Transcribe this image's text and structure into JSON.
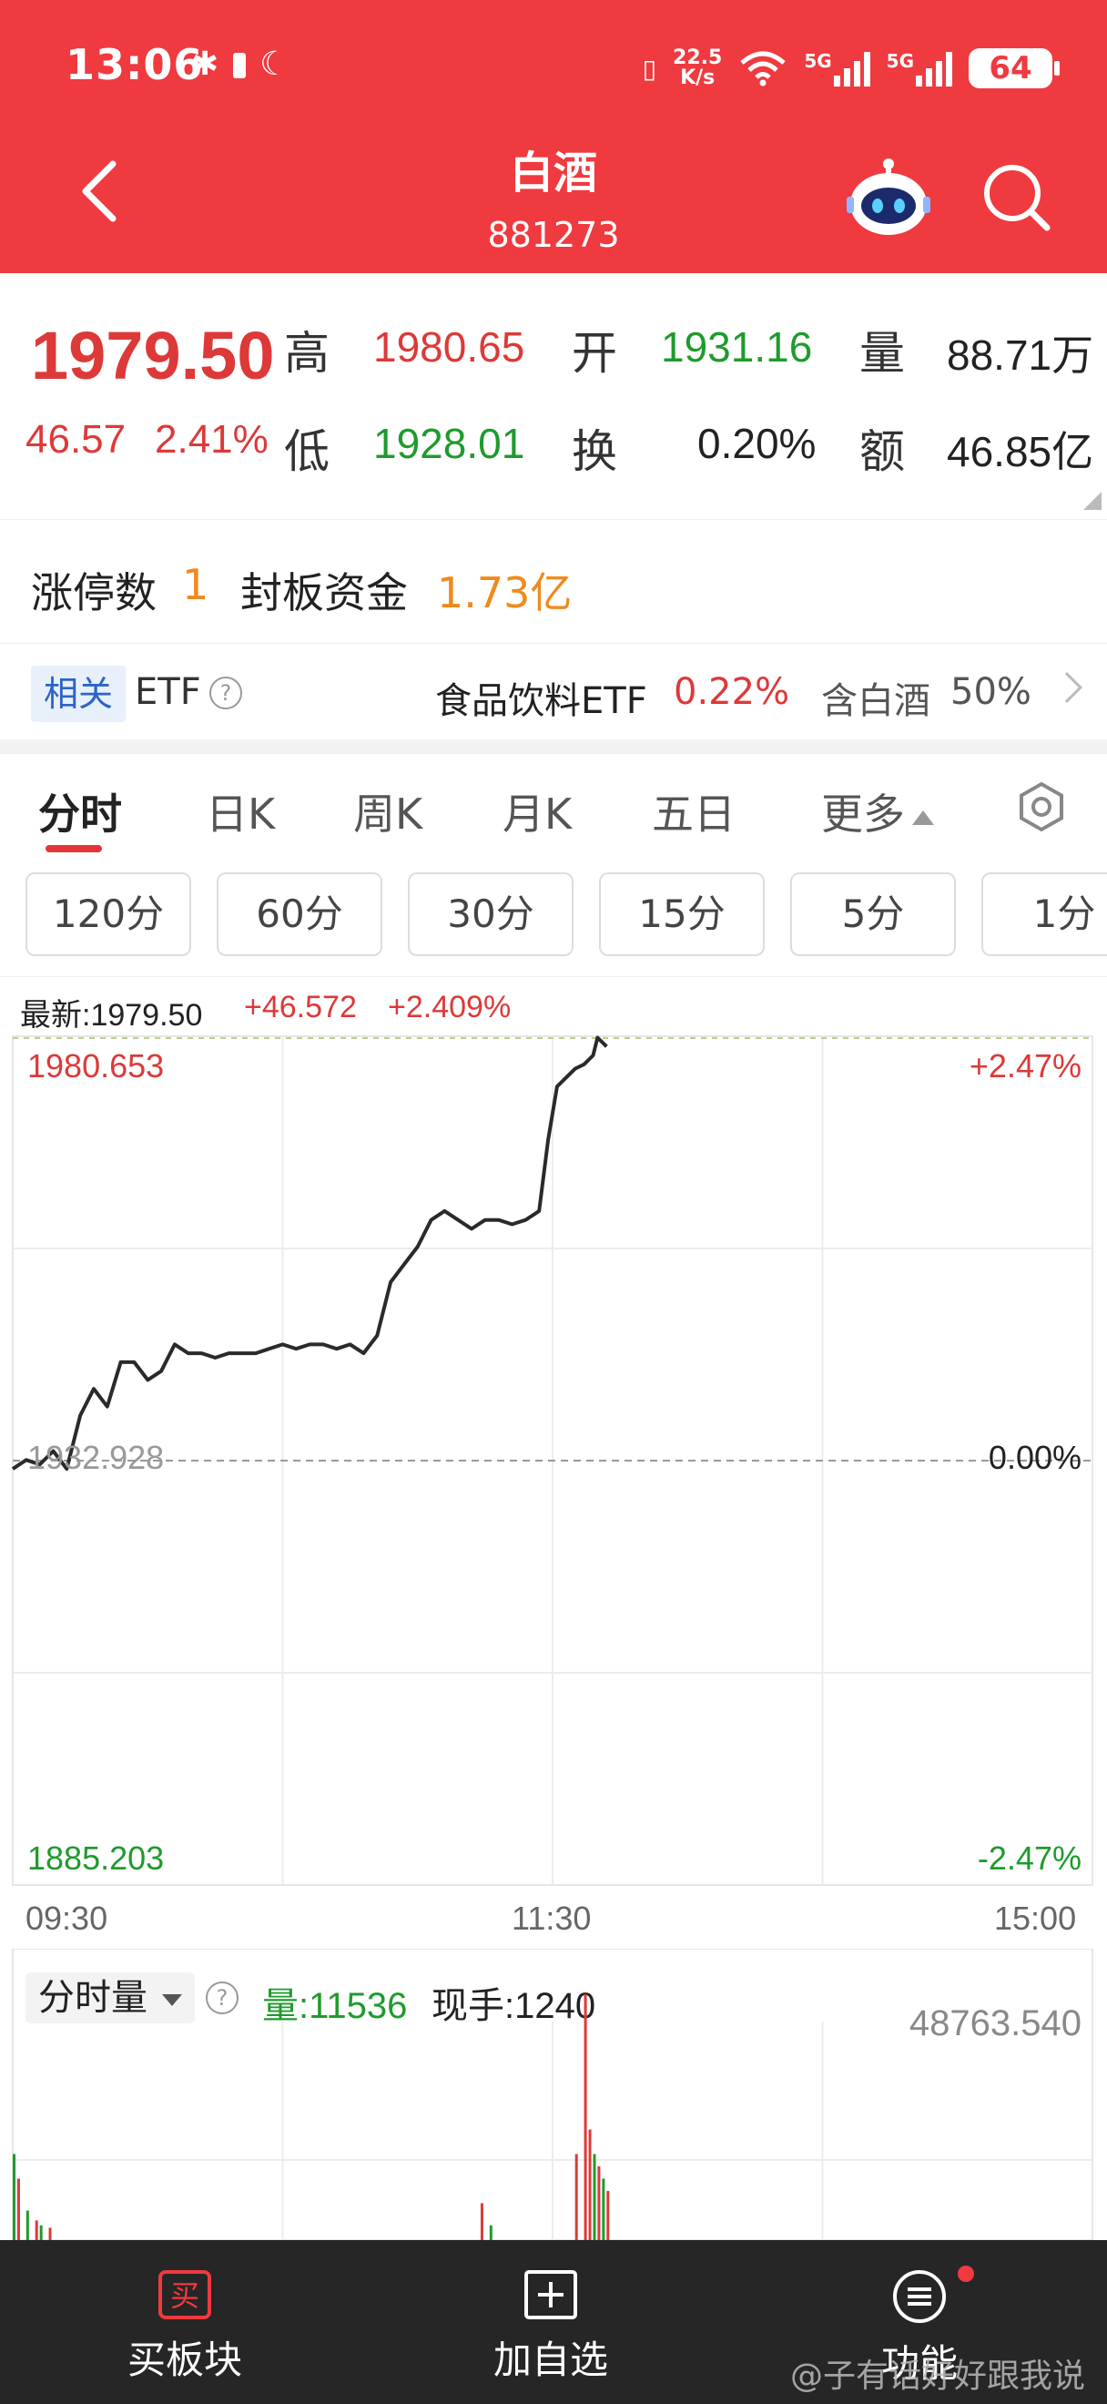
{
  "status_bar": {
    "time": "13:06",
    "net_speed_value": "22.5",
    "net_speed_unit": "K/s",
    "sig1_label": "5G",
    "sig2_label": "5G",
    "battery": "64"
  },
  "header": {
    "title": "白酒",
    "code": "881273"
  },
  "quote": {
    "price": "1979.50",
    "change": "46.57",
    "change_pct": "2.41%",
    "high_label": "高",
    "high": "1980.65",
    "open_label": "开",
    "open": "1931.16",
    "volume_label": "量",
    "volume": "88.71万",
    "low_label": "低",
    "low": "1928.01",
    "turnover_label": "换",
    "turnover": "0.20%",
    "amount_label": "额",
    "amount": "46.85亿"
  },
  "limit_up": {
    "count_label": "涨停数",
    "count": "1",
    "fund_label": "封板资金",
    "fund": "1.73亿"
  },
  "etf": {
    "tag": "相关",
    "label": "ETF",
    "name": "食品饮料ETF",
    "pct": "0.22%",
    "contains": "含白酒",
    "contains_pct": "50%"
  },
  "tabs": [
    {
      "label": "分时"
    },
    {
      "label": "日K"
    },
    {
      "label": "周K"
    },
    {
      "label": "月K"
    },
    {
      "label": "五日"
    },
    {
      "label": "更多"
    }
  ],
  "intervals": [
    {
      "label": "120分"
    },
    {
      "label": "60分"
    },
    {
      "label": "30分"
    },
    {
      "label": "15分"
    },
    {
      "label": "5分"
    },
    {
      "label": "1分"
    }
  ],
  "latest": {
    "label": "最新:1979.50",
    "change": "+46.572",
    "pct": "+2.409%"
  },
  "chart_data": {
    "type": "line",
    "y_top": "1980.653",
    "y_mid": "1932.928",
    "y_bottom": "1885.203",
    "pct_top": "+2.47%",
    "pct_mid": "0.00%",
    "pct_bottom": "-2.47%",
    "x_labels": [
      "09:30",
      "11:30",
      "15:00"
    ],
    "ylim": [
      1885.203,
      1980.653
    ],
    "x": [
      0,
      3,
      6,
      9,
      12,
      15,
      18,
      21,
      24,
      27,
      30,
      33,
      36,
      39,
      42,
      45,
      48,
      51,
      54,
      57,
      60,
      63,
      66,
      69,
      72,
      75,
      78,
      81,
      84,
      87,
      90,
      93,
      96,
      99,
      102,
      105,
      108,
      111,
      114,
      117,
      119,
      120,
      121,
      123,
      125,
      127,
      129,
      130,
      131,
      132
    ],
    "values": [
      1932.0,
      1933.0,
      1932.5,
      1934.0,
      1932.0,
      1938.0,
      1941.0,
      1939.0,
      1944.0,
      1944.0,
      1942.0,
      1943.0,
      1946.0,
      1945.0,
      1945.0,
      1944.5,
      1945.0,
      1945.0,
      1945.0,
      1945.5,
      1946.0,
      1945.5,
      1946.0,
      1946.0,
      1945.5,
      1946.0,
      1945.0,
      1947.0,
      1953.0,
      1955.0,
      1957.0,
      1960.0,
      1961.0,
      1960.0,
      1959.0,
      1960.0,
      1960.0,
      1959.5,
      1960.0,
      1961.0,
      1969.0,
      1972.0,
      1975.0,
      1976.0,
      1977.0,
      1977.5,
      1978.5,
      1980.5,
      1980.0,
      1979.5
    ],
    "series": [
      {
        "name": "",
        "values": []
      }
    ]
  },
  "volume": {
    "dropdown": "分时量",
    "qty_label": "量:11536",
    "hand_label": "现手:1240",
    "max_value": "48763.540",
    "bars": [
      {
        "x": 0,
        "v": 0.35,
        "c": "green"
      },
      {
        "x": 1,
        "v": 0.25,
        "c": "red"
      },
      {
        "x": 3,
        "v": 0.12,
        "c": "green"
      },
      {
        "x": 5,
        "v": 0.08,
        "c": "red"
      },
      {
        "x": 6,
        "v": 0.06,
        "c": "green"
      },
      {
        "x": 8,
        "v": 0.05,
        "c": "red"
      },
      {
        "x": 104,
        "v": 0.15,
        "c": "red"
      },
      {
        "x": 106,
        "v": 0.06,
        "c": "green"
      },
      {
        "x": 125,
        "v": 0.35,
        "c": "red"
      },
      {
        "x": 127,
        "v": 1.0,
        "c": "red"
      },
      {
        "x": 128,
        "v": 0.45,
        "c": "red"
      },
      {
        "x": 129,
        "v": 0.35,
        "c": "green"
      },
      {
        "x": 130,
        "v": 0.3,
        "c": "red"
      },
      {
        "x": 131,
        "v": 0.25,
        "c": "green"
      },
      {
        "x": 132,
        "v": 0.2,
        "c": "red"
      }
    ]
  },
  "bottom_bar": {
    "buy_icon": "买",
    "buy_label": "买板块",
    "add_label": "加自选",
    "func_label": "功能",
    "watermark": "@子有话好好跟我说"
  }
}
